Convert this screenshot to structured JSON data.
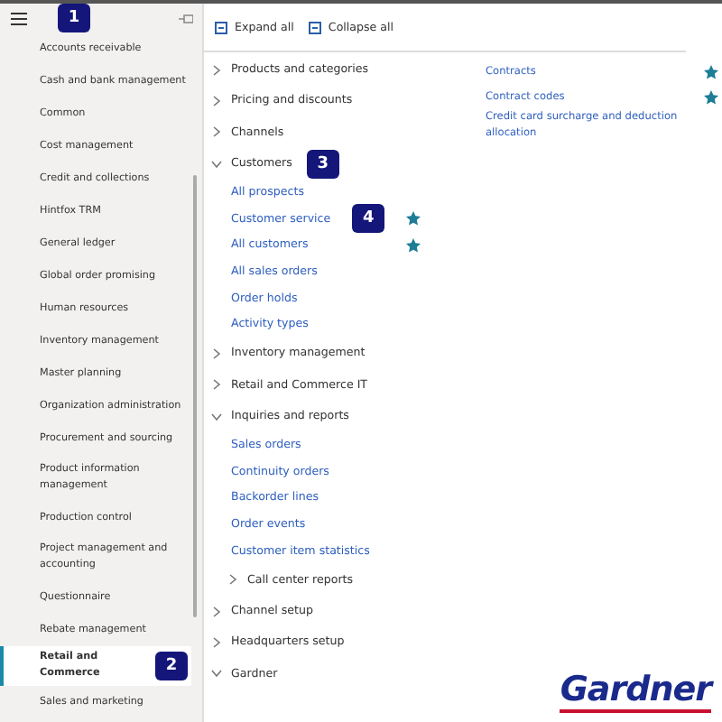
{
  "sidebar": {
    "callout": "1",
    "items": [
      {
        "label": "Accounts receivable",
        "selected": false
      },
      {
        "label": "Cash and bank management",
        "selected": false
      },
      {
        "label": "Common",
        "selected": false
      },
      {
        "label": "Cost management",
        "selected": false
      },
      {
        "label": "Credit and collections",
        "selected": false
      },
      {
        "label": "Hintfox TRM",
        "selected": false
      },
      {
        "label": "General ledger",
        "selected": false
      },
      {
        "label": "Global order promising",
        "selected": false
      },
      {
        "label": "Human resources",
        "selected": false
      },
      {
        "label": "Inventory management",
        "selected": false
      },
      {
        "label": "Master planning",
        "selected": false
      },
      {
        "label": "Organization administration",
        "selected": false
      },
      {
        "label": "Procurement and sourcing",
        "selected": false
      },
      {
        "label": "Product information management",
        "selected": false
      },
      {
        "label": "Production control",
        "selected": false
      },
      {
        "label": "Project management and accounting",
        "selected": false
      },
      {
        "label": "Questionnaire",
        "selected": false
      },
      {
        "label": "Rebate management",
        "selected": false
      },
      {
        "label": "Retail and Commerce",
        "selected": true,
        "callout": "2"
      },
      {
        "label": "Sales and marketing",
        "selected": false
      }
    ]
  },
  "toolbar": {
    "expand_all": "Expand all",
    "collapse_all": "Collapse all"
  },
  "tree": [
    {
      "kind": "group",
      "label": "Products and categories",
      "expanded": false
    },
    {
      "kind": "group",
      "label": "Pricing and discounts",
      "expanded": false
    },
    {
      "kind": "group",
      "label": "Channels",
      "expanded": false
    },
    {
      "kind": "group",
      "label": "Customers",
      "expanded": true,
      "callout": "3",
      "children": [
        {
          "kind": "link",
          "label": "All prospects",
          "favorite": false
        },
        {
          "kind": "link",
          "label": "Customer service",
          "favorite": true,
          "callout": "4"
        },
        {
          "kind": "link",
          "label": "All customers",
          "favorite": true
        },
        {
          "kind": "link",
          "label": "All sales orders",
          "favorite": false
        },
        {
          "kind": "link",
          "label": "Order holds",
          "favorite": false
        },
        {
          "kind": "link",
          "label": "Activity types",
          "favorite": false
        }
      ]
    },
    {
      "kind": "group",
      "label": "Inventory management",
      "expanded": false
    },
    {
      "kind": "group",
      "label": "Retail and Commerce IT",
      "expanded": false
    },
    {
      "kind": "group",
      "label": "Inquiries and reports",
      "expanded": true,
      "children": [
        {
          "kind": "link",
          "label": "Sales orders",
          "favorite": false
        },
        {
          "kind": "link",
          "label": "Continuity orders",
          "favorite": false
        },
        {
          "kind": "link",
          "label": "Backorder lines",
          "favorite": false
        },
        {
          "kind": "link",
          "label": "Order events",
          "favorite": false
        },
        {
          "kind": "link",
          "label": "Customer item statistics",
          "favorite": false
        },
        {
          "kind": "group",
          "label": "Call center reports",
          "expanded": false
        }
      ]
    },
    {
      "kind": "group",
      "label": "Channel setup",
      "expanded": false
    },
    {
      "kind": "group",
      "label": "Headquarters setup",
      "expanded": false
    },
    {
      "kind": "group",
      "label": "Gardner",
      "expanded": true
    }
  ],
  "side_links": [
    {
      "label": "Contracts",
      "favorite": true
    },
    {
      "label": "Contract codes",
      "favorite": true
    },
    {
      "label": "Credit card surcharge and deduction allocation",
      "favorite": false
    }
  ],
  "logo": {
    "text": "Gardner"
  }
}
